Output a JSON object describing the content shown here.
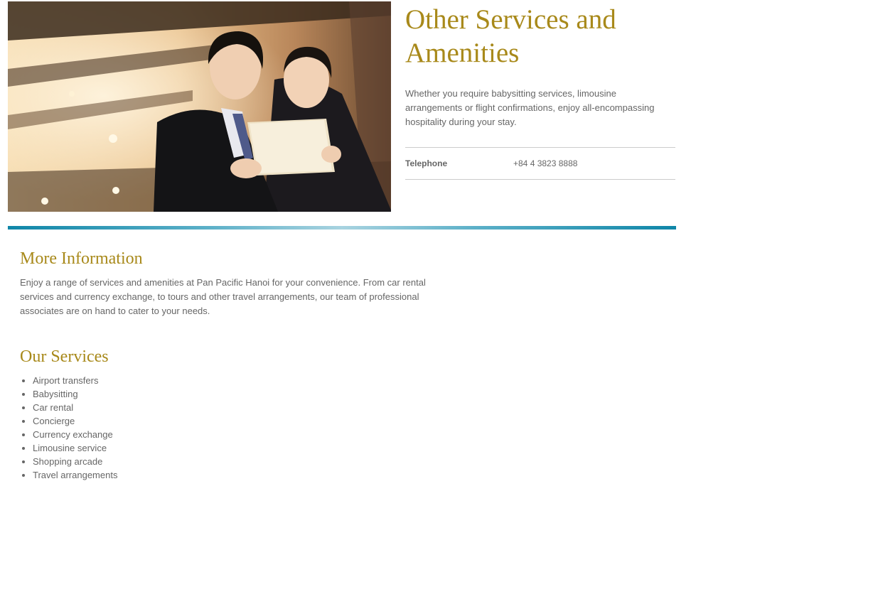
{
  "hero": {
    "alt": "Two business associates looking at a tablet"
  },
  "intro": {
    "title": "Other Services and Amenities",
    "text": "Whether you require babysitting services, limousine arrangements or flight confirmations, enjoy all-encompassing hospitality during your stay.",
    "contact": {
      "label": "Telephone",
      "value": "+84 4 3823 8888"
    }
  },
  "more_info": {
    "title": "More Information",
    "text": "Enjoy a range of services and amenities at Pan Pacific Hanoi for your convenience. From car rental services and currency exchange, to tours and other travel arrangements, our team of professional associates are on hand to cater to your needs."
  },
  "services": {
    "title": "Our Services",
    "items": [
      "Airport transfers",
      "Babysitting",
      "Car rental",
      "Concierge",
      "Currency exchange",
      "Limousine service",
      "Shopping arcade",
      "Travel arrangements"
    ]
  },
  "colors": {
    "heading": "#a8891a",
    "body_text": "#666666",
    "divider_accent": "#0f86a8",
    "rule": "#cccccc"
  }
}
